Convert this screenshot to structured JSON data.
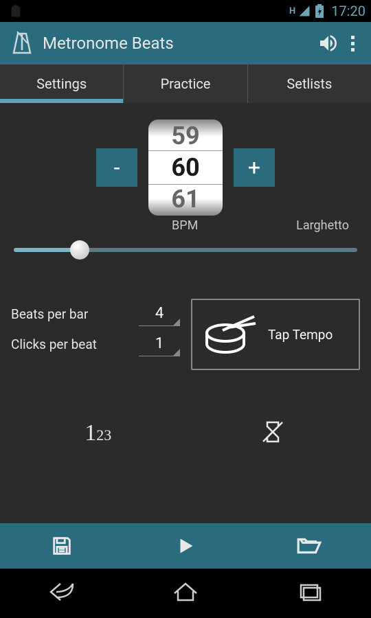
{
  "status_bar": {
    "data": "H",
    "time": "17:20"
  },
  "app_bar": {
    "title": "Metronome Beats"
  },
  "tabs": [
    {
      "label": "Settings",
      "active": true
    },
    {
      "label": "Practice",
      "active": false
    },
    {
      "label": "Setlists",
      "active": false
    }
  ],
  "bpm": {
    "prev": "59",
    "current": "60",
    "next": "61",
    "unit_label": "BPM",
    "tempo_name": "Larghetto",
    "minus": "-",
    "plus": "+"
  },
  "settings": {
    "beats_per_bar_label": "Beats per bar",
    "beats_per_bar_value": "4",
    "clicks_per_beat_label": "Clicks per beat",
    "clicks_per_beat_value": "1"
  },
  "tap_tempo": {
    "label": "Tap Tempo"
  },
  "counter": {
    "text": "123"
  }
}
